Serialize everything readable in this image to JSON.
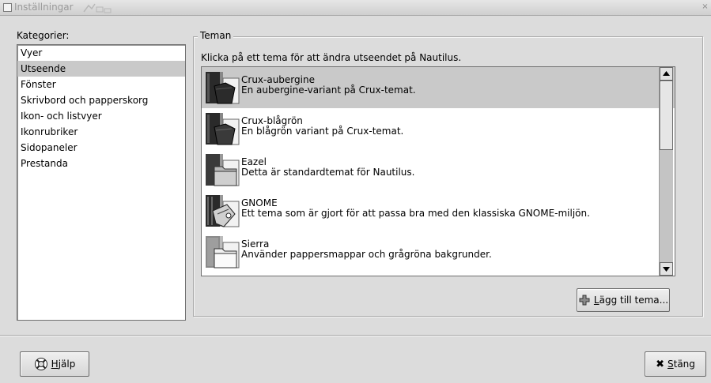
{
  "window": {
    "title": "Inställningar",
    "close_glyph": "×"
  },
  "categories": {
    "label": "Kategorier:",
    "items": [
      {
        "label": "Vyer",
        "selected": false
      },
      {
        "label": "Utseende",
        "selected": true
      },
      {
        "label": "Fönster",
        "selected": false
      },
      {
        "label": "Skrivbord och papperskorg",
        "selected": false
      },
      {
        "label": "Ikon- och listvyer",
        "selected": false
      },
      {
        "label": "Ikonrubriker",
        "selected": false
      },
      {
        "label": "Sidopaneler",
        "selected": false
      },
      {
        "label": "Prestanda",
        "selected": false
      }
    ]
  },
  "themes": {
    "frame_label": "Teman",
    "description": "Klicka på ett tema för att ändra utseendet på Nautilus.",
    "items": [
      {
        "name": "Crux-aubergine",
        "desc": "En aubergine-variant på Crux-temat.",
        "icon": "dark-folder-icon",
        "selected": true
      },
      {
        "name": "Crux-blågrön",
        "desc": "En blågrön variant på Crux-temat.",
        "icon": "dark-folder-icon",
        "selected": false
      },
      {
        "name": "Eazel",
        "desc": "Detta är standardtemat för Nautilus.",
        "icon": "folder-icon",
        "selected": false
      },
      {
        "name": "GNOME",
        "desc": "Ett tema som är gjort för att passa bra med den klassiska GNOME-miljön.",
        "icon": "gnome-folder-icon",
        "selected": false
      },
      {
        "name": "Sierra",
        "desc": "Använder pappersmappar och grågröna bakgrunder.",
        "icon": "paper-folder-icon",
        "selected": false
      }
    ],
    "add_button": {
      "mnemonic": "L",
      "rest": "ägg till tema..."
    }
  },
  "footer": {
    "help_button": {
      "mnemonic": "H",
      "rest": "jälp"
    },
    "close_button": {
      "glyph": "✖",
      "mnemonic": "S",
      "rest": "täng"
    }
  },
  "colors": {
    "background": "#dcdcdc",
    "selection": "#c9c9c9"
  }
}
